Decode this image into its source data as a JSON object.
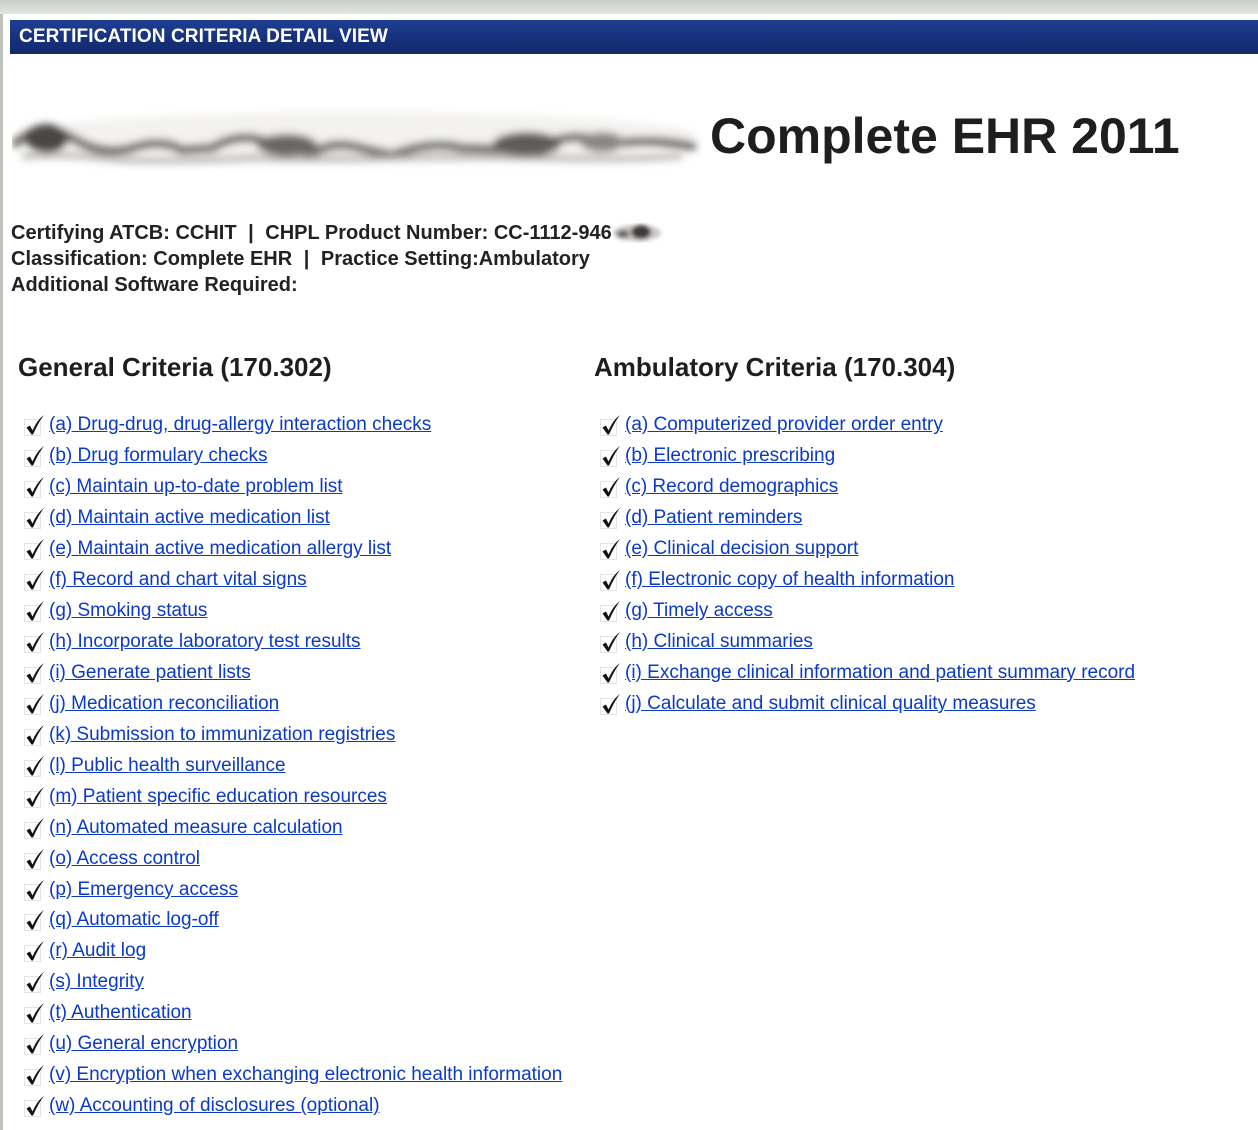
{
  "header": {
    "title": "CERTIFICATION CRITERIA DETAIL VIEW"
  },
  "product": {
    "title": "Complete EHR 2011"
  },
  "info": {
    "atcb_label": "Certifying ATCB:",
    "atcb_value": "CCHIT",
    "chpl_label": "CHPL Product Number:",
    "chpl_value": "CC-1112-946",
    "classification_label": "Classification:",
    "classification_value": "Complete EHR",
    "practice_label": "Practice Setting:",
    "practice_value": "Ambulatory",
    "software_label": "Additional Software Required:"
  },
  "general": {
    "title": "General Criteria (170.302)",
    "items": [
      "(a) Drug-drug, drug-allergy interaction checks",
      "(b) Drug formulary checks",
      "(c) Maintain up-to-date problem list",
      "(d) Maintain active medication list",
      "(e) Maintain active medication allergy list",
      "(f) Record and chart vital signs",
      "(g) Smoking status",
      "(h) Incorporate laboratory test results",
      "(i) Generate patient lists",
      "(j) Medication reconciliation",
      "(k) Submission to immunization registries",
      "(l) Public health surveillance",
      "(m) Patient specific education resources",
      "(n) Automated measure calculation",
      "(o) Access control",
      "(p) Emergency access",
      "(q) Automatic log-off",
      "(r) Audit log",
      "(s) Integrity",
      "(t) Authentication",
      "(u) General encryption",
      "(v) Encryption when exchanging electronic health information",
      "(w) Accounting of disclosures (optional)"
    ]
  },
  "ambulatory": {
    "title": "Ambulatory Criteria (170.304)",
    "items": [
      "(a) Computerized provider order entry",
      "(b) Electronic prescribing",
      "(c) Record demographics",
      "(d) Patient reminders",
      "(e) Clinical decision support",
      "(f) Electronic copy of health information",
      "(g) Timely access",
      "(h) Clinical summaries",
      "(i) Exchange clinical information and patient summary record",
      "(j) Calculate and submit clinical quality measures"
    ]
  },
  "icons": {
    "check": "checkmark-icon"
  },
  "colors": {
    "header_bg": "#1a3582",
    "link": "#0b3ac7"
  }
}
